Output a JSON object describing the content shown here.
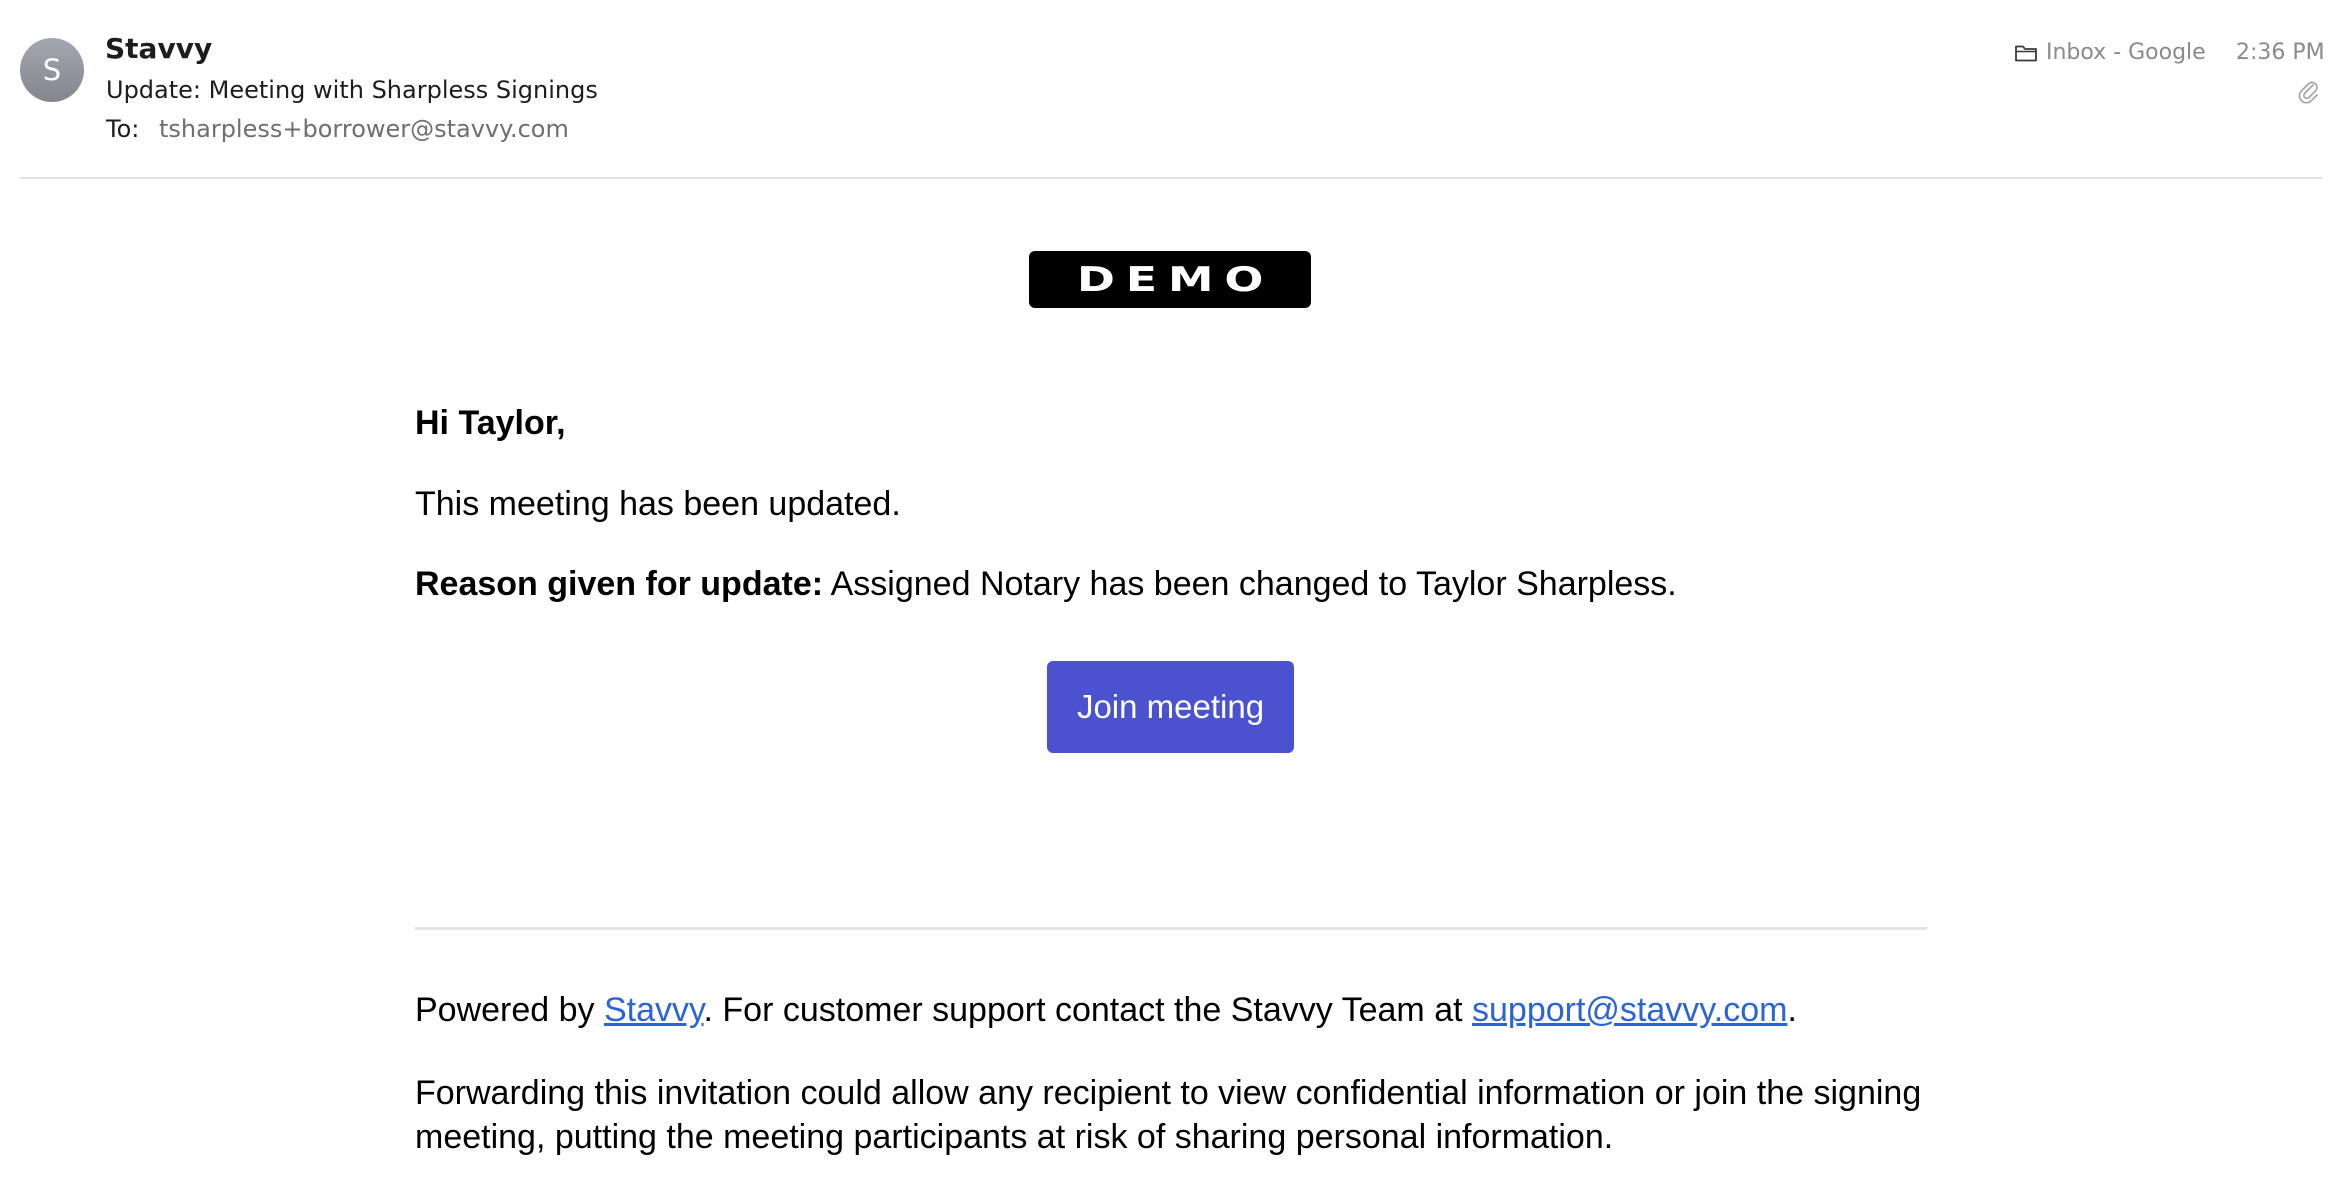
{
  "header": {
    "avatar_initial": "S",
    "sender": "Stavvy",
    "subject": "Update: Meeting with Sharpless Signings",
    "to_label": "To:",
    "to_address": "tsharpless+borrower@stavvy.com",
    "mailbox": "Inbox - Google",
    "mailbox_icon": "folder-icon",
    "time": "2:36 PM",
    "attachment_icon": "paperclip-icon"
  },
  "email": {
    "logo_text": "DEMO",
    "greeting": "Hi Taylor,",
    "updated_text": "This meeting has been updated.",
    "reason_label": "Reason given for update:",
    "reason_text": " Assigned Notary has been changed to Taylor Sharpless.",
    "join_button": "Join meeting",
    "footer": {
      "powered_prefix": "Powered by ",
      "powered_link": "Stavvy",
      "support_text": ". For customer support contact the Stavvy Team at ",
      "support_email": "support@stavvy.com",
      "support_suffix": ".",
      "forward_warning": "Forwarding this invitation could allow any recipient to view confidential information or join the signing meeting, putting the meeting participants at risk of sharing personal information."
    }
  },
  "colors": {
    "button": "#4b52cf",
    "link": "#2a64d6",
    "avatar": "#92949e",
    "meta_text": "#8a8a8e"
  }
}
